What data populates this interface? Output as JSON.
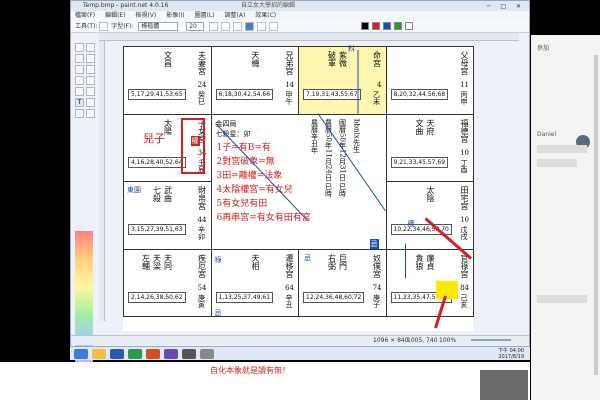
{
  "window": {
    "title": "Temp.bmp - paint.net 4.0.16",
    "center_title": "自立女大學招的編輯",
    "controls": "─ □ ✕"
  },
  "menu": [
    "檔案(F)",
    "編輯(E)",
    "檢視(V)",
    "影像(I)",
    "圖層(L)",
    "調整(A)",
    "效果(C)"
  ],
  "toolbar": {
    "tool_label": "工具(T):",
    "font_label": "字型(F):",
    "font_name": "標楷體",
    "size": "20"
  },
  "chart": {
    "palaces": [
      {
        "name": "夫妻宮",
        "stars": [
          "文昌"
        ],
        "num": "24",
        "ganzhi": "癸巳",
        "nums": "5,17,29,41,53,65"
      },
      {
        "name": "兄弟宮",
        "stars": [
          "天機"
        ],
        "num": "14",
        "ganzhi": "甲午",
        "nums": "6,18,30,42,54,66"
      },
      {
        "name": "命宮",
        "stars": [
          "紫微",
          "破軍"
        ],
        "num": "4",
        "ganzhi": "乙未",
        "nums": "7,19,31,43,55,67"
      },
      {
        "name": "父母宮",
        "stars": [],
        "num": "11",
        "ganzhi": "丙申",
        "nums": "8,20,32,44,56,68"
      },
      {
        "name": "子女宮",
        "stars": [
          "太陽"
        ],
        "num": "34",
        "ganzhi": "壬辰",
        "nums": "4,16,28,40,52,64"
      },
      {
        "name": "福德宮",
        "stars": [
          "天府",
          "文曲"
        ],
        "num": "10",
        "ganzhi": "丁酉",
        "nums": "9,21,33,45,57,69"
      },
      {
        "name": "財帛宮",
        "stars": [
          "武曲",
          "七殺"
        ],
        "num": "44",
        "ganzhi": "辛卯",
        "nums": "3,15,27,39,51,63"
      },
      {
        "name": "田宅宮",
        "stars": [
          "太陰"
        ],
        "num": "10",
        "ganzhi": "戊戌",
        "nums": "10,22,34,46,58,70"
      },
      {
        "name": "疾厄宮",
        "stars": [
          "天同",
          "天梁",
          "左輔"
        ],
        "num": "54",
        "ganzhi": "庚寅",
        "nums": "2,14,26,38,50,62"
      },
      {
        "name": "遷移宮",
        "stars": [
          "天相"
        ],
        "num": "64",
        "ganzhi": "辛丑",
        "nums": "1,13,25,37,49,61"
      },
      {
        "name": "奴僕宮",
        "stars": [
          "巨門",
          "右弼"
        ],
        "num": "74",
        "ganzhi": "庚子",
        "nums": "12,24,36,48,60,72"
      },
      {
        "name": "官祿宮",
        "stars": [
          "廉貞",
          "貪狼"
        ],
        "num": "84",
        "ganzhi": "己亥",
        "nums": "11,23,35,47,59,71"
      }
    ],
    "center": {
      "ju": "金四局",
      "zhu": "七殺星：卯",
      "name": "bbnix先生",
      "lunar": "國曆50年12月31日 巳時",
      "solar": "農曆50年11月24日 巳時",
      "lunar2": "農曆辛丑年"
    },
    "hua_ji_tag": "權",
    "hua_ji_tag2": "忌",
    "blue_tags": [
      "科",
      "東園",
      "權",
      "忌",
      "祿",
      "忌"
    ],
    "annotation_title": "兒子",
    "annotations": [
      "1子=有B=有",
      "2對宮破象=無",
      "3田=離權=法象",
      "4太陰權宮=有女兒",
      "5有女兒有田",
      "6再串宮=有女有田有宮"
    ]
  },
  "status": {
    "size": "1096 × 840",
    "pos": "1005, 740",
    "zoom": "100%"
  },
  "sidebar": {
    "label1": "參加",
    "label2": "Daniel"
  },
  "taskbar": {
    "time": "下午 04:00",
    "date": "2017/8/19"
  },
  "subtitle": "自化本象就是讀有無！"
}
